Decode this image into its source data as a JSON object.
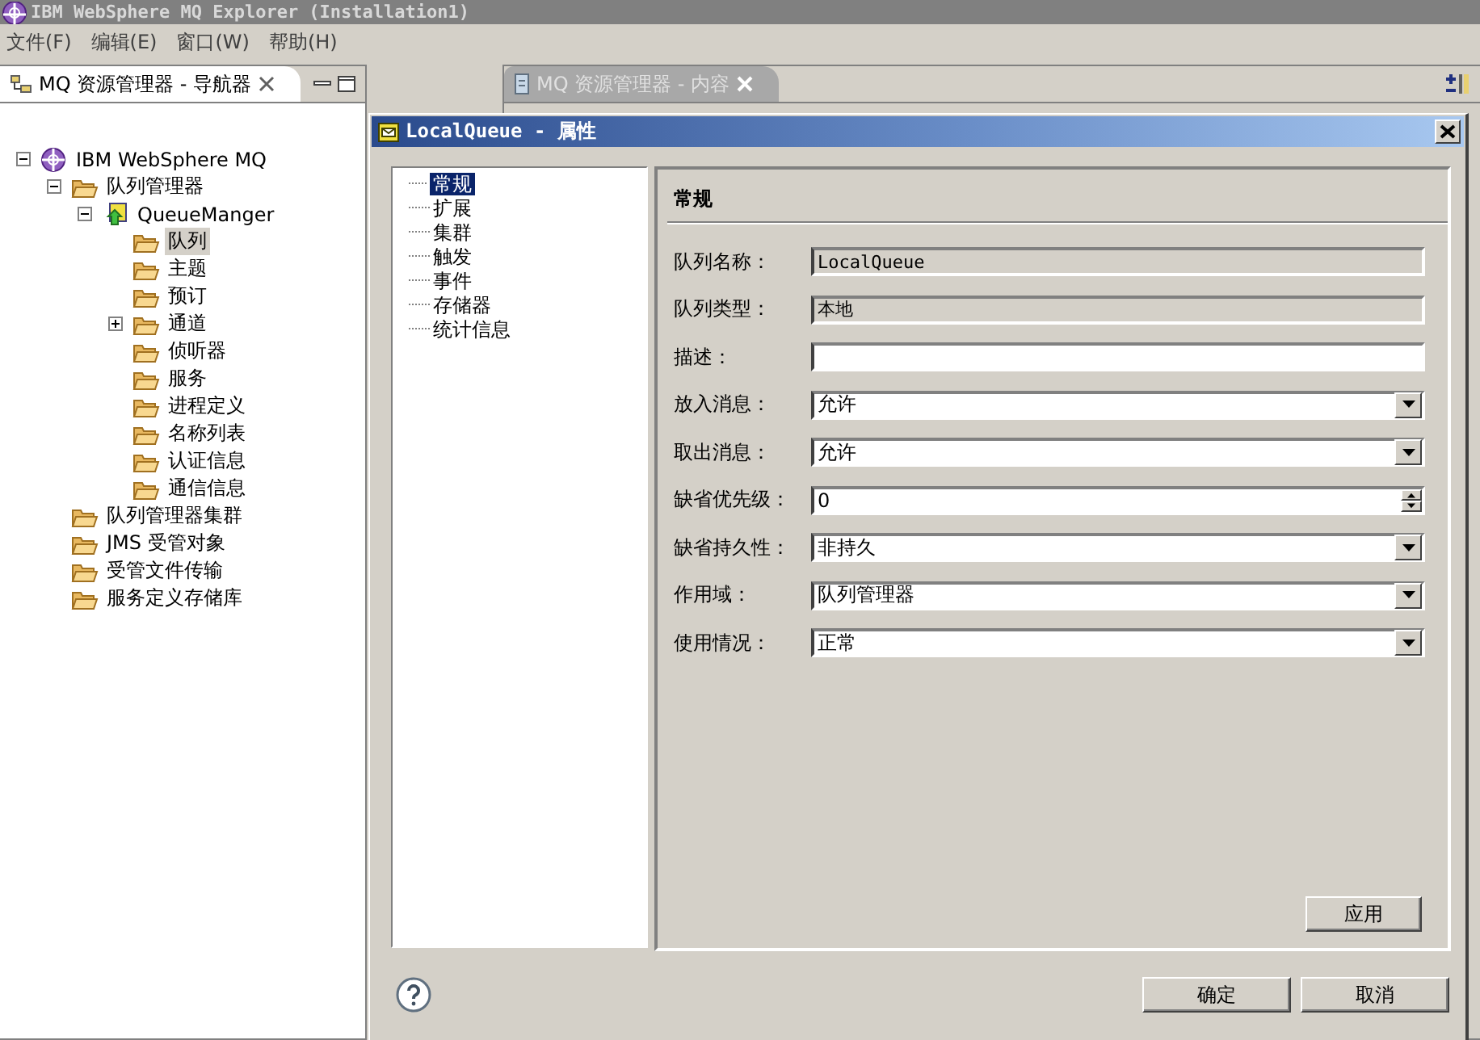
{
  "window": {
    "title": "IBM WebSphere MQ Explorer (Installation1)"
  },
  "menu": [
    "文件(F)",
    "编辑(E)",
    "窗口(W)",
    "帮助(H)"
  ],
  "navigator_view": {
    "tab": "MQ 资源管理器 - 导航器",
    "tree": [
      {
        "label": "IBM WebSphere MQ",
        "kind": "root",
        "selected": false,
        "expanded": true,
        "children": [
          {
            "label": "队列管理器",
            "kind": "folder",
            "selected": false,
            "expanded": true,
            "children": [
              {
                "label": "QueueManger",
                "kind": "qmgr",
                "selected": false,
                "expanded": true,
                "children": [
                  {
                    "label": "队列",
                    "kind": "folder",
                    "selected": true
                  },
                  {
                    "label": "主题",
                    "kind": "folder",
                    "selected": false
                  },
                  {
                    "label": "预订",
                    "kind": "folder",
                    "selected": false
                  },
                  {
                    "label": "通道",
                    "kind": "folder",
                    "selected": false,
                    "expanded": false
                  },
                  {
                    "label": "侦听器",
                    "kind": "folder",
                    "selected": false
                  },
                  {
                    "label": "服务",
                    "kind": "folder",
                    "selected": false
                  },
                  {
                    "label": "进程定义",
                    "kind": "folder",
                    "selected": false
                  },
                  {
                    "label": "名称列表",
                    "kind": "folder",
                    "selected": false
                  },
                  {
                    "label": "认证信息",
                    "kind": "folder",
                    "selected": false
                  },
                  {
                    "label": "通信信息",
                    "kind": "folder",
                    "selected": false
                  }
                ]
              }
            ]
          },
          {
            "label": "队列管理器集群",
            "kind": "folder",
            "selected": false
          },
          {
            "label": "JMS 受管对象",
            "kind": "folder",
            "selected": false
          },
          {
            "label": "受管文件传输",
            "kind": "folder",
            "selected": false
          },
          {
            "label": "服务定义存储库",
            "kind": "folder",
            "selected": false
          }
        ]
      }
    ]
  },
  "content_view": {
    "tab": "MQ 资源管理器 - 内容"
  },
  "dialog": {
    "title": "LocalQueue - 属性",
    "pages": [
      {
        "label": "常规",
        "selected": true
      },
      {
        "label": "扩展",
        "selected": false
      },
      {
        "label": "集群",
        "selected": false
      },
      {
        "label": "触发",
        "selected": false
      },
      {
        "label": "事件",
        "selected": false
      },
      {
        "label": "存储器",
        "selected": false
      },
      {
        "label": "统计信息",
        "selected": false
      }
    ],
    "section_title": "常规",
    "fields": [
      {
        "label": "队列名称：",
        "kind": "readonly",
        "value": "LocalQueue"
      },
      {
        "label": "队列类型：",
        "kind": "readonly",
        "value": "本地"
      },
      {
        "label": "描述：",
        "kind": "text"
      },
      {
        "label": "放入消息：",
        "kind": "dropdown",
        "value": "允许"
      },
      {
        "label": "取出消息：",
        "kind": "dropdown",
        "value": "允许"
      },
      {
        "label": "缺省优先级：",
        "kind": "spinner",
        "value": "0"
      },
      {
        "label": "缺省持久性：",
        "kind": "dropdown",
        "value": "非持久"
      },
      {
        "label": "作用域：",
        "kind": "dropdown",
        "value": "队列管理器"
      },
      {
        "label": "使用情况：",
        "kind": "dropdown",
        "value": "正常"
      }
    ],
    "apply": "应用",
    "ok": "确定",
    "cancel": "取消"
  }
}
